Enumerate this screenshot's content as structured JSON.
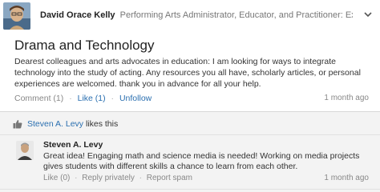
{
  "post": {
    "author_name": "David Orace Kelly",
    "author_title": "Performing Arts Administrator, Educator, and Practitioner: Explorer...",
    "title": "Drama and Technology",
    "body": "Dearest colleagues and arts advocates in education: I am looking for ways to integrate technology into the study of acting. Any resources you all have, scholarly articles, or personal experiences are welcomed. thank you in advance for all your help.",
    "comment_label": "Comment (1)",
    "like_label": "Like (1)",
    "unfollow_label": "Unfollow",
    "time": "1 month ago"
  },
  "likes": {
    "liker_name": "Steven A. Levy",
    "suffix": "likes this"
  },
  "comment": {
    "author_name": "Steven A. Levy",
    "body": "Great idea! Engaging math and science media is needed! Working on media projects gives students with different skills a chance to learn from each other.",
    "like_label": "Like (0)",
    "reply_label": "Reply privately",
    "report_label": "Report spam",
    "time": "1 month ago"
  },
  "icons": {
    "chevron": "chevron-down-icon",
    "thumb": "thumbs-up-icon"
  },
  "colors": {
    "link": "#2a6fb0",
    "muted": "#888888",
    "panel": "#f3f3f3"
  }
}
